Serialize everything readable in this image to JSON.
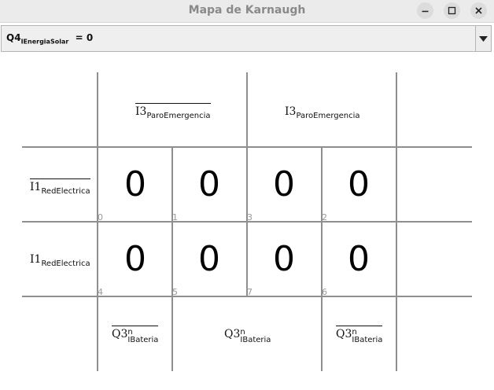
{
  "window": {
    "title": "Mapa de Karnaugh",
    "buttons": [
      "minimize-icon",
      "maximize-icon",
      "close-icon"
    ]
  },
  "selector": {
    "label_main": "Q4",
    "label_sub": "IEnergiaSolar",
    "label_value": "= 0"
  },
  "kmap": {
    "col_headers": [
      {
        "var": "I3",
        "sub": "ParoEmergencia",
        "negated": true
      },
      {
        "var": "I3",
        "sub": "ParoEmergencia",
        "negated": false
      }
    ],
    "row_headers": [
      {
        "var": "I1",
        "sub": "RedElectrica",
        "negated": true
      },
      {
        "var": "I1",
        "sub": "RedElectrica",
        "negated": false
      }
    ],
    "bottom_headers": [
      {
        "var": "Q3",
        "sup": "n",
        "sub": "IBateria",
        "negated": true
      },
      {
        "var": "Q3",
        "sup": "n",
        "sub": "IBateria",
        "negated": false
      },
      {
        "var": "Q3",
        "sup": "n",
        "sub": "IBateria",
        "negated": true
      }
    ],
    "cells": [
      [
        {
          "value": "0",
          "index": "0"
        },
        {
          "value": "0",
          "index": "1"
        },
        {
          "value": "0",
          "index": "3"
        },
        {
          "value": "0",
          "index": "2"
        }
      ],
      [
        {
          "value": "0",
          "index": "4"
        },
        {
          "value": "0",
          "index": "5"
        },
        {
          "value": "0",
          "index": "7"
        },
        {
          "value": "0",
          "index": "6"
        }
      ]
    ]
  }
}
